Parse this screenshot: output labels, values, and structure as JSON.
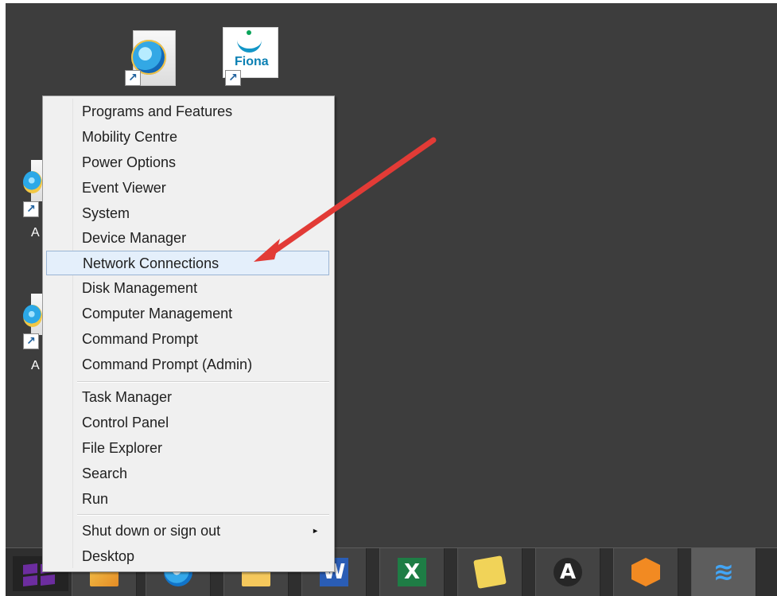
{
  "desktop": {
    "icons": [
      {
        "name": "Internet Explorer shortcut",
        "icon": "ie-icon"
      },
      {
        "name": "Fiona shortcut",
        "icon": "fiona-icon",
        "label": "Fiona"
      }
    ],
    "partial_labels": [
      "A",
      "A"
    ],
    "colors": {
      "desktop": "#3d3d3d",
      "menu_background": "#f0f0f0",
      "highlight": "#e4effb",
      "arrow": "#e23b36"
    }
  },
  "context_menu": {
    "items": [
      {
        "label": "Programs and Features"
      },
      {
        "label": "Mobility Centre"
      },
      {
        "label": "Power Options"
      },
      {
        "label": "Event Viewer"
      },
      {
        "label": "System"
      },
      {
        "label": "Device Manager"
      },
      {
        "label": "Network Connections",
        "highlighted": true
      },
      {
        "label": "Disk Management"
      },
      {
        "label": "Computer Management"
      },
      {
        "label": "Command Prompt"
      },
      {
        "label": "Command Prompt (Admin)"
      },
      {
        "label": "Task Manager"
      },
      {
        "label": "Control Panel"
      },
      {
        "label": "File Explorer"
      },
      {
        "label": "Search"
      },
      {
        "label": "Run"
      },
      {
        "label": "Shut down or sign out",
        "has_submenu": true,
        "submenu_arrow": "▸"
      },
      {
        "label": "Desktop"
      }
    ]
  },
  "taskbar": {
    "apps": [
      {
        "name": "Windows Start",
        "icon": "windows-logo-icon"
      },
      {
        "name": "Outlook",
        "icon": "outlook-icon"
      },
      {
        "name": "Internet Explorer",
        "icon": "internet-explorer-icon"
      },
      {
        "name": "File Explorer",
        "icon": "folder-icon"
      },
      {
        "name": "Word",
        "icon": "word-icon",
        "glyph": "W"
      },
      {
        "name": "Excel",
        "icon": "excel-icon",
        "glyph": "X"
      },
      {
        "name": "Sticky Notes",
        "icon": "sticky-notes-icon"
      },
      {
        "name": "Anchor app",
        "icon": "anchor-icon",
        "glyph": "A"
      },
      {
        "name": "Cube app",
        "icon": "cube-icon"
      },
      {
        "name": "Wi-Fi",
        "icon": "wifi-icon",
        "glyph": "≋"
      }
    ]
  }
}
